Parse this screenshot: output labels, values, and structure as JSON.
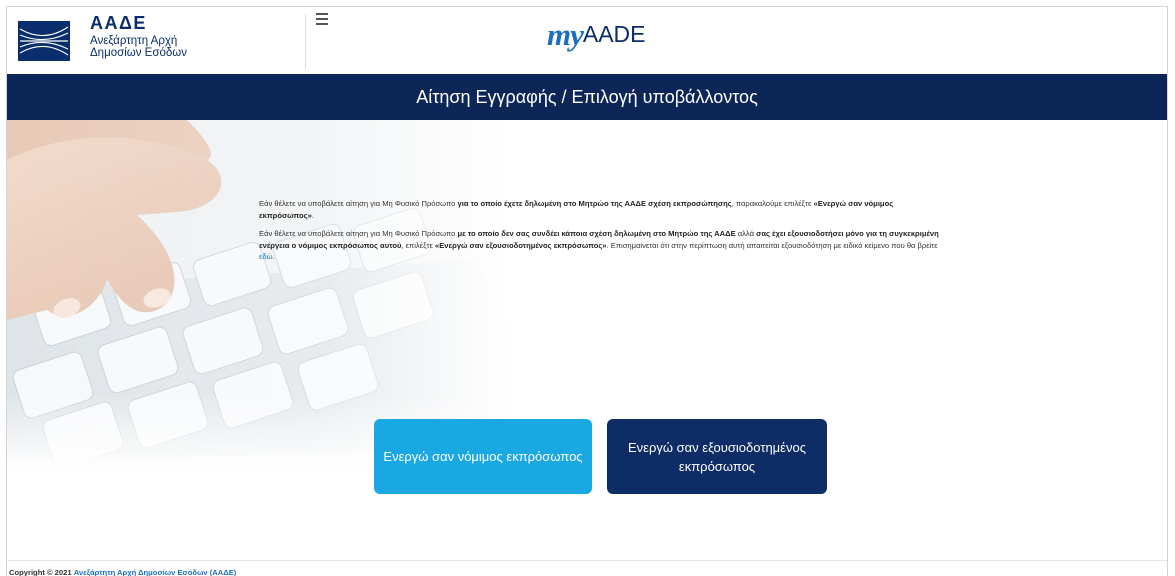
{
  "header": {
    "logo_acronym": "ΑΑΔΕ",
    "logo_line1": "Ανεξάρτητη Αρχή",
    "logo_line2": "Δημοσίων Εσόδων",
    "brand_my": "my",
    "brand_aade": "AADE"
  },
  "title_bar": {
    "title": "Αίτηση Εγγραφής / Επιλογή υποβάλλοντος"
  },
  "info": {
    "p1_a": "Εάν θέλετε να υποβάλετε αίτηση για Μη Φυσικό Πρόσωπο ",
    "p1_b": "για το οποίο έχετε δηλωμένη στο Μητρώο της ΑΑΔΕ σχέση εκπροσώπησης",
    "p1_c": ", παρακαλούμε επιλέξτε ",
    "p1_d": "«Ενεργώ σαν νόμιμος εκπρόσωπος»",
    "p1_e": ".",
    "p2_a": "Εάν θέλετε να υποβάλετε αίτηση για Μη Φυσικό Πρόσωπο ",
    "p2_b": "με το οποίο δεν σας συνδέει κάποια σχέση δηλωμένη στο Μητρώο της ΑΑΔΕ",
    "p2_c": " αλλά ",
    "p2_d": "σας έχει εξουσιοδοτήσει μόνο για τη συγκεκριμένη ενέργεια ο νόμιμος εκπρόσωπος αυτού",
    "p2_e": ", επιλέξτε ",
    "p2_f": "«Ενεργώ σαν εξουσιοδοτημένος εκπρόσωπος»",
    "p2_g": ". Επισημαίνεται ότι στην περίπτωση αυτή απαιτείται εξουσιοδότηση με ειδικό κείμενο που θα βρείτε ",
    "p2_link": "εδώ",
    "p2_h": "."
  },
  "buttons": {
    "legal_rep": "Ενεργώ σαν νόμιμος εκπρόσωπος",
    "authorized_rep": "Ενεργώ σαν εξουσιοδοτημένος εκπρόσωπος"
  },
  "footer": {
    "copyright": "Copyright © 2021 ",
    "link": "Ανεξάρτητη Αρχή Δημοσίων Εσόδων (ΑΑΔΕ)"
  },
  "colors": {
    "navy": "#0c2658",
    "light_blue_button": "#1aa8e3",
    "dark_blue_button": "#0e2c66",
    "brand_blue": "#1a6fc2"
  },
  "icons": {
    "logo": "aade-logo-icon",
    "menu": "hamburger-menu-icon"
  }
}
